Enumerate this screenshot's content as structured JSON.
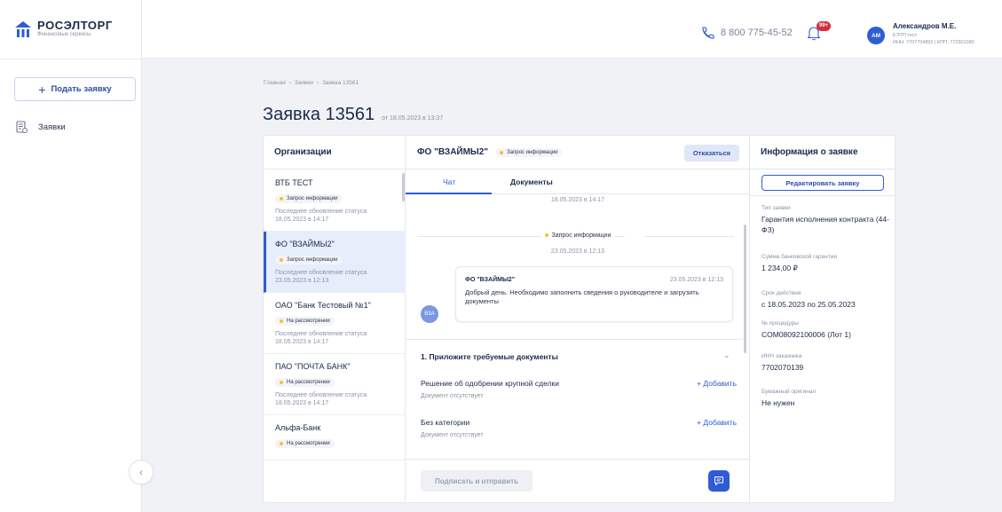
{
  "brand": {
    "name": "РОСЭЛТОРГ",
    "subtitle": "Финансовые сервисы"
  },
  "sidebar": {
    "apply_button": "Подать заявку",
    "items": [
      {
        "label": "Заявки",
        "icon": "document-list-icon"
      }
    ]
  },
  "header": {
    "phone": "8 800 775-45-52",
    "notifications_badge": "99+",
    "user": {
      "initials": "АМ",
      "name": "Александров М.Е.",
      "org": "ЕЭТП тест",
      "ids": "ИНН: 7707704892 | КПП: 772501080"
    }
  },
  "breadcrumb": [
    "Главная",
    "Заявки",
    "Заявка 13561"
  ],
  "breadcrumb_sep": "›",
  "page": {
    "title": "Заявка 13561",
    "date": "от 18.05.2023 в 13:37"
  },
  "orgs": {
    "heading": "Организации",
    "items": [
      {
        "name": "ВТБ ТЕСТ",
        "status": "Запрос информации",
        "update_label": "Последнее обновление статуса",
        "update_date": "18.05.2023 в 14:17"
      },
      {
        "name": "ФО \"ВЗАЙМЫ2\"",
        "status": "Запрос информации",
        "update_label": "Последнее обновление статуса",
        "update_date": "23.05.2023 в 12:13"
      },
      {
        "name": "ОАО \"Банк Тестовый №1\"",
        "status": "На рассмотрении",
        "update_label": "Последнее обновление статуса",
        "update_date": "18.05.2023 в 14:17"
      },
      {
        "name": "ПАО \"ПОЧТА БАНК\"",
        "status": "На рассмотрении",
        "update_label": "Последнее обновление статуса",
        "update_date": "18.05.2023 в 14:17"
      },
      {
        "name": "Альфа-Банк",
        "status": "На рассмотрении"
      }
    ]
  },
  "chat": {
    "org_name": "ФО \"ВЗАЙМЫ2\"",
    "status": "Запрос информации",
    "decline_button": "Отказаться",
    "tabs": [
      "Чат",
      "Документы"
    ],
    "timestamp_top": "18.05.2023 в 14:17",
    "system_event": "Запрос информации",
    "system_event_date": "23.05.2023 в 12:13",
    "message": {
      "author": "ФО \"ВЗАЙМЫ2\"",
      "time": "23.05.2023 в 12:13",
      "text": "Добрый день. Необходимо заполнить сведения о руководителе и загрузить документы",
      "avatar": "ВЗА"
    },
    "docs": {
      "title": "1. Приложите требуемые документы",
      "rows": [
        {
          "name": "Решение об одобрении крупной сделки",
          "status": "Документ отсутствует",
          "action": "+ Добавить"
        },
        {
          "name": "Без категории",
          "status": "Документ отсутствует",
          "action": "+ Добавить"
        }
      ]
    },
    "sign_button": "Подписать и отправить"
  },
  "info": {
    "heading": "Информация о заявке",
    "edit_button": "Редактировать заявку",
    "fields": [
      {
        "label": "Тип заявки",
        "value": "Гарантия исполнения контракта (44-ФЗ)"
      },
      {
        "label": "Сумма банковской гарантии",
        "value": "1 234,00 ₽"
      },
      {
        "label": "Срок действия",
        "value": "с 18.05.2023 по 25.05.2023"
      },
      {
        "label": "№ процедуры",
        "value": "COM08092100006 (Лот 1)"
      },
      {
        "label": "ИНН заказчика",
        "value": "7702070139"
      },
      {
        "label": "Бумажный оригинал",
        "value": "Не нужен"
      }
    ]
  },
  "colors": {
    "accent": "#2f5bd6",
    "status_dot": "#f2c230",
    "badge": "#d72e3a"
  }
}
